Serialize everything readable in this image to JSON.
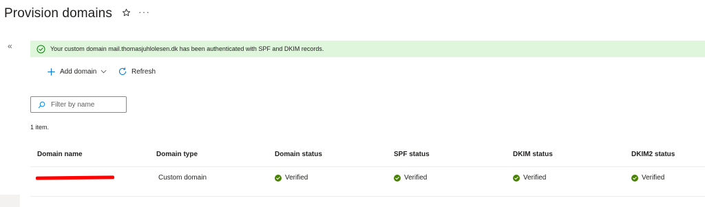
{
  "page": {
    "title": "Provision domains"
  },
  "header": {
    "more_label": "···"
  },
  "nav": {
    "collapse_label": "«"
  },
  "banner": {
    "text": "Your custom domain mail.thomasjuhlolesen.dk has been authenticated with SPF and DKIM records.",
    "color": "#dff6dd",
    "icon": "check-circle-icon"
  },
  "toolbar": {
    "add_label": "Add domain",
    "refresh_label": "Refresh"
  },
  "filter": {
    "placeholder": "Filter by name",
    "value": ""
  },
  "list": {
    "count_text": "1 item.",
    "columns": [
      "Domain name",
      "Domain type",
      "Domain status",
      "SPF status",
      "DKIM status",
      "DKIM2 status"
    ],
    "rows": [
      {
        "domain_name": "",
        "domain_name_redacted": true,
        "domain_type": "Custom domain",
        "domain_status": "Verified",
        "spf_status": "Verified",
        "dkim_status": "Verified",
        "dkim2_status": "Verified"
      }
    ]
  },
  "colors": {
    "accent": "#0078d4",
    "success": "#498205",
    "banner_bg": "#dff6dd"
  }
}
